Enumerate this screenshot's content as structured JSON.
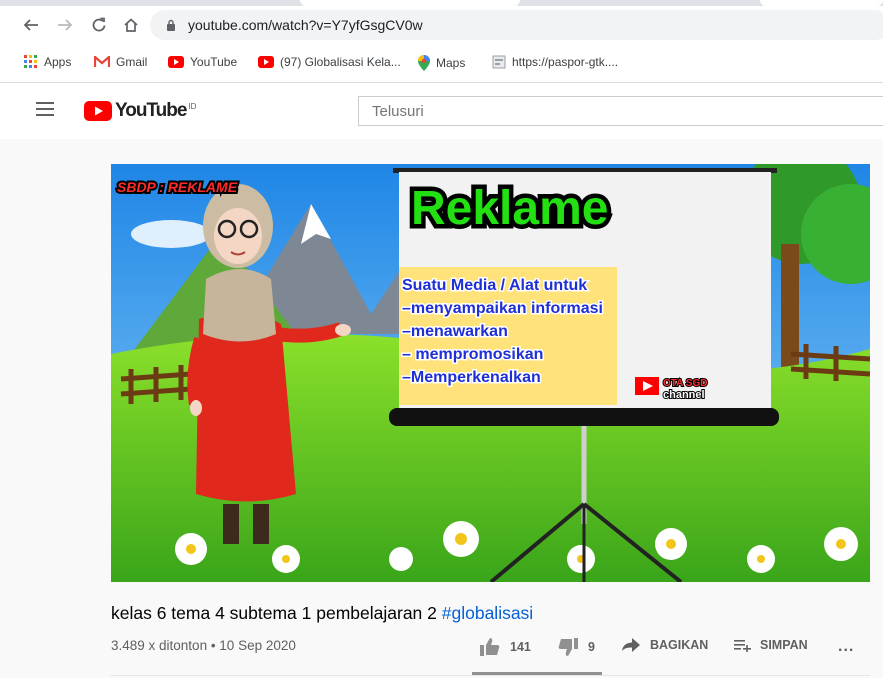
{
  "browser": {
    "url": "youtube.com/watch?v=Y7yfGsgCV0w",
    "bookmarks": [
      {
        "label": "Apps",
        "icon": "apps-grid-icon"
      },
      {
        "label": "Gmail",
        "icon": "gmail-icon"
      },
      {
        "label": "YouTube",
        "icon": "youtube-icon"
      },
      {
        "label": "(97) Globalisasi Kela...",
        "icon": "youtube-icon"
      },
      {
        "label": "Maps",
        "icon": "maps-pin-icon"
      },
      {
        "label": "https://paspor-gtk....",
        "icon": "page-icon"
      }
    ]
  },
  "youtube": {
    "logo_text": "YouTube",
    "country": "ID",
    "search_placeholder": "Telusuri"
  },
  "video": {
    "thumbnail": {
      "corner_label": "SBDP : REKLAME",
      "board_title": "Reklame",
      "board_lines": [
        "Suatu Media / Alat untuk",
        "–menyampaikan informasi",
        "–menawarkan",
        "– mempromosikan",
        "–Memperkenalkan"
      ],
      "channel_mark_top": "OTA SGD",
      "channel_mark_bottom": "channel"
    },
    "title_text": "kelas 6 tema 4 subtema 1 pembelajaran 2 ",
    "title_tag": "#globalisasi",
    "views_date": "3.489 x ditonton • 10 Sep 2020",
    "likes": "141",
    "dislikes": "9",
    "share_label": "BAGIKAN",
    "save_label": "SIMPAN",
    "more_label": "..."
  },
  "colors": {
    "youtube_red": "#ff0000",
    "link_blue": "#065fd4",
    "board_title_green": "#22e012",
    "board_text_blue": "#1f2fd6",
    "board_note_bg": "#ffe27a"
  }
}
